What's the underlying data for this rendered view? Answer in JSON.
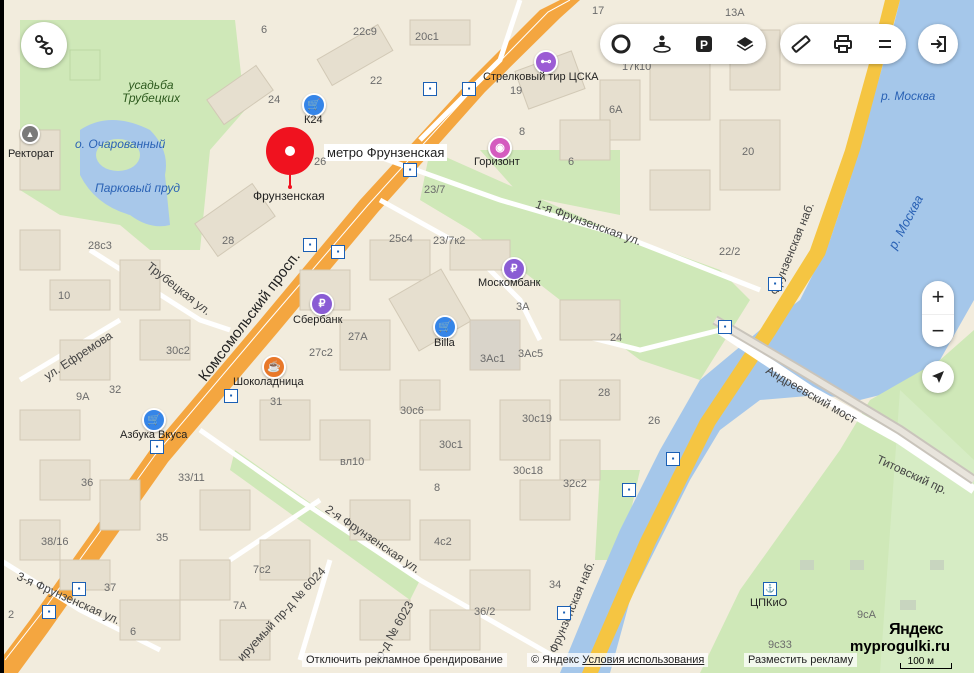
{
  "map": {
    "roads": {
      "komsomolsky": "Комсомольский просп.",
      "frunzenskaya_nab_upper": "Фрунзенская наб.",
      "frunzenskaya_nab_lower": "Фрунзенская наб.",
      "first_frunzenskaya": "1-я Фрунзенская ул.",
      "second_frunzenskaya": "2-я Фрунзенская ул.",
      "third_frunzenskaya": "3-я Фрунзенская ул.",
      "trubetskaya": "Трубецкая ул.",
      "efremova": "ул. Ефремова",
      "andreevsky_bridge": "Андреевский мост",
      "titovsky": "Титовский пр.",
      "proezd_6024": "ируемый пр-д № 6024",
      "proezd_6023": "пр-д № 6023"
    },
    "places": {
      "usadba": "усадьба Трубецких",
      "ocharovanny": "о. Очарованный",
      "park_pond": "Парковый пруд",
      "moskva_river_1": "р. Москва",
      "moskva_river_2": "р. Москва",
      "rectorat": "Ректорат"
    },
    "pois": {
      "metro": "метро Фрунзенская",
      "metro_sub": "Фрунзенская",
      "k24": "К24",
      "shooting": "Стрелковый тир ЦСКА",
      "horizont": "Горизонт",
      "moskombank": "Москомбанк",
      "sberbank": "Сбербанк",
      "billa": "Billa",
      "shokoladnitsa": "Шоколадница",
      "azbuka": "Азбука Вкуса",
      "cpkio": "ЦПКиО"
    },
    "house_numbers": {
      "h1": "6",
      "h2": "22с9",
      "h3": "20с1",
      "h4": "17",
      "h5": "13А",
      "h6": "22",
      "h7": "19",
      "h8": "17к10",
      "h9": "24",
      "h10": "6А",
      "h11": "26",
      "h12": "8",
      "h13": "6",
      "h14": "20",
      "h15": "23/7",
      "h16": "25с4",
      "h17": "23/7к2",
      "h18": "22/2",
      "h19": "28",
      "h20": "28с3",
      "h21": "10",
      "h22": "3А",
      "h23": "27А",
      "h24": "24",
      "h25": "30с2",
      "h26": "27с2",
      "h27": "3Ас1",
      "h28": "3Ас5",
      "h29": "9А",
      "h30": "32",
      "h31": "31",
      "h32": "28",
      "h33": "30с6",
      "h34": "30с19",
      "h35": "26",
      "h36": "30с1",
      "h37": "вл10",
      "h38": "30с18",
      "h39": "33/11",
      "h40": "32с2",
      "h41": "8",
      "h42": "36",
      "h43": "35",
      "h44": "4с2",
      "h45": "38/16",
      "h46": "7с2",
      "h47": "37",
      "h48": "7А",
      "h49": "34",
      "h50": "36/2",
      "h51": "9сА",
      "h52": "9с33",
      "h53": "6",
      "h54": "2"
    },
    "controls": {
      "zoom_in": "+",
      "zoom_out": "−"
    },
    "footer": {
      "disable_branding": "Отключить рекламное брендирование",
      "copyright": "© Яндекс",
      "terms": "Условия использования",
      "advertise": "Разместить рекламу",
      "logo": "Яндекс",
      "watermark": "myprogulki.ru",
      "scale": "100 м"
    },
    "colors": {
      "land": "#f2ecdd",
      "park": "#cfe8b8",
      "water": "#a5c7ea",
      "main_road": "#f4a640",
      "embankment": "#f5c542",
      "metro_marker": "#f0121f"
    },
    "icons": {
      "route": "route-icon",
      "traffic": "traffic-icon",
      "panorama": "panorama-icon",
      "parking": "parking-icon",
      "layers": "layers-icon",
      "ruler": "ruler-icon",
      "print": "print-icon",
      "menu": "menu-icon",
      "login": "login-icon",
      "locate": "locate-icon"
    }
  }
}
